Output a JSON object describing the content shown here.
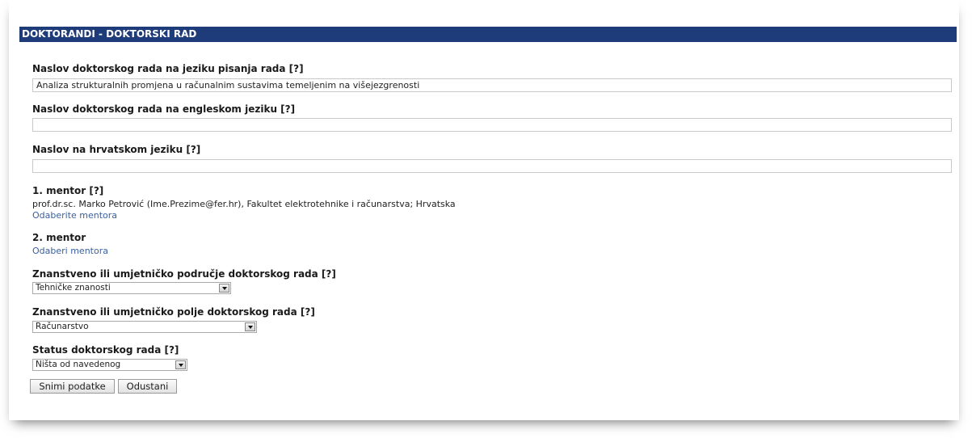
{
  "header": {
    "title": "DOKTORANDI - DOKTORSKI RAD"
  },
  "fields": {
    "title_original": {
      "label": "Naslov doktorskog rada na jeziku pisanja rada [?]",
      "value": "Analiza strukturalnih promjena u računalnim sustavima temeljenim na višejezgrenosti"
    },
    "title_english": {
      "label": "Naslov doktorskog rada na engleskom jeziku [?]",
      "value": ""
    },
    "title_croatian": {
      "label": "Naslov na hrvatskom jeziku [?]",
      "value": ""
    }
  },
  "mentor1": {
    "label": "1. mentor [?]",
    "text": "prof.dr.sc. Marko Petrović (Ime.Prezime@fer.hr), Fakultet elektrotehnike i računarstva; Hrvatska",
    "link": "Odaberite mentora"
  },
  "mentor2": {
    "label": "2. mentor",
    "link": "Odaberi mentora"
  },
  "area": {
    "label": "Znanstveno ili umjetničko područje doktorskog rada [?]",
    "selected": "Tehničke znanosti"
  },
  "field": {
    "label": "Znanstveno ili umjetničko polje doktorskog rada [?]",
    "selected": "Računarstvo"
  },
  "status": {
    "label": "Status doktorskog rada [?]",
    "selected": "Ništa od navedenog"
  },
  "buttons": {
    "save": "Snimi podatke",
    "cancel": "Odustani"
  }
}
